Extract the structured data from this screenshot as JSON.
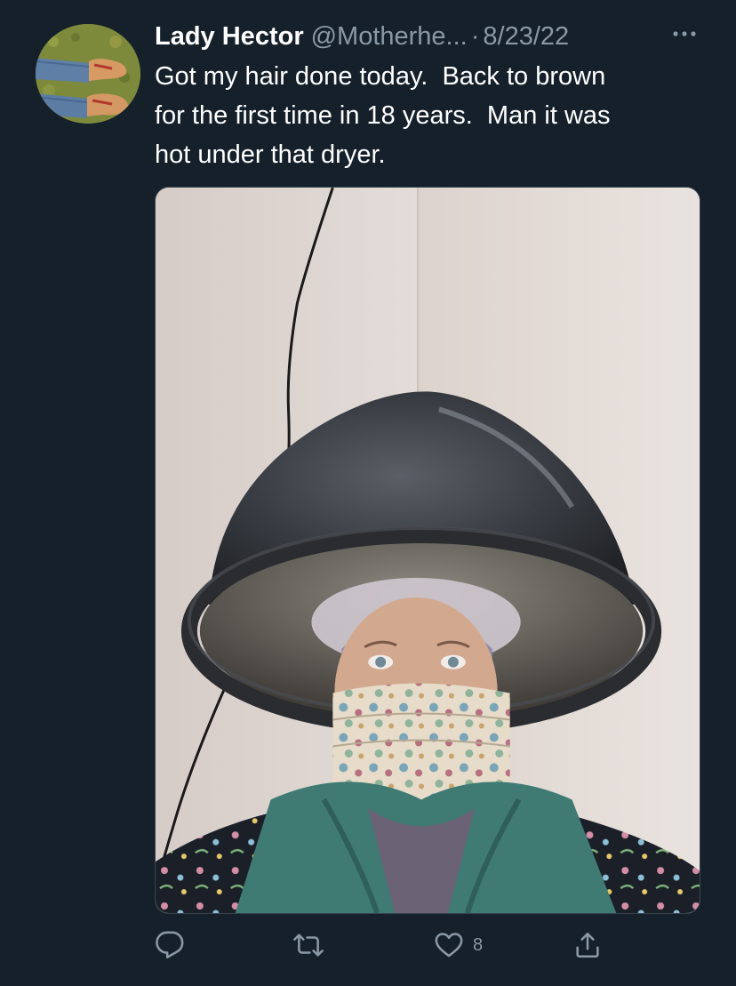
{
  "tweet": {
    "display_name": "Lady Hector",
    "handle": "@Motherhe...",
    "separator": "·",
    "date": "8/23/22",
    "text": "Got my hair done today.  Back to brown\nfor the first time in 18 years.  Man it was\nhot under that dryer.",
    "like_count": "8",
    "reply_count": "",
    "retweet_count": ""
  },
  "icons": {
    "more": "more-icon",
    "reply": "reply-icon",
    "retweet": "retweet-icon",
    "like": "heart-icon",
    "share": "share-icon"
  },
  "colors": {
    "background": "#15202b",
    "text_primary": "#ffffff",
    "text_secondary": "#8b98a5",
    "border": "#38444d"
  }
}
